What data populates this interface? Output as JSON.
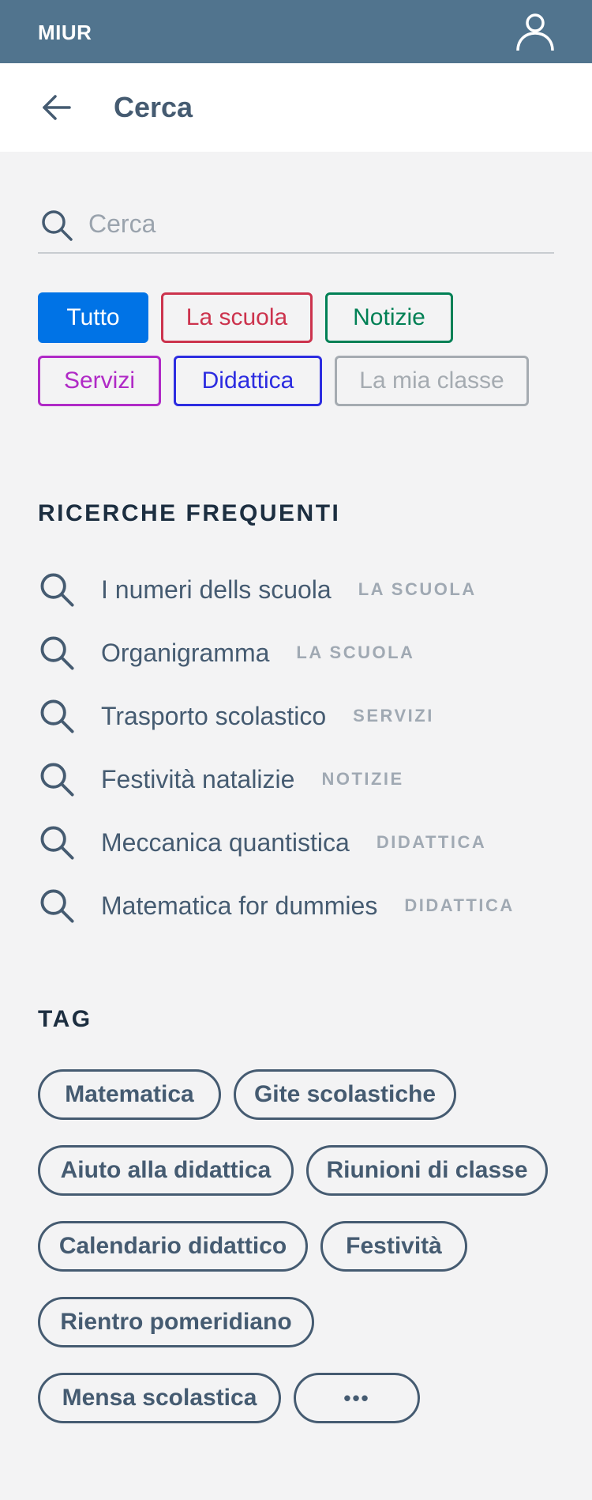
{
  "app": {
    "brand": "MIUR"
  },
  "header": {
    "title": "Cerca"
  },
  "search": {
    "placeholder": "Cerca",
    "value": ""
  },
  "filters": [
    {
      "label": "Tutto",
      "selected": true,
      "color": "#0073e6"
    },
    {
      "label": "La scuola",
      "selected": false,
      "color": "#cc334d"
    },
    {
      "label": "Notizie",
      "selected": false,
      "color": "#008055"
    },
    {
      "label": "Servizi",
      "selected": false,
      "color": "#b02ac6"
    },
    {
      "label": "Didattica",
      "selected": false,
      "color": "#2c2ce0"
    },
    {
      "label": "La mia classe",
      "selected": false,
      "color": "#a5abb1"
    }
  ],
  "frequent": {
    "title": "RICERCHE FREQUENTI",
    "items": [
      {
        "text": "I numeri dells scuola",
        "category": "LA SCUOLA"
      },
      {
        "text": "Organigramma",
        "category": "LA SCUOLA"
      },
      {
        "text": "Trasporto scolastico",
        "category": "SERVIZI"
      },
      {
        "text": "Festività natalizie",
        "category": "NOTIZIE"
      },
      {
        "text": "Meccanica quantistica",
        "category": "DIDATTICA"
      },
      {
        "text": "Matematica for dummies",
        "category": "DIDATTICA"
      }
    ]
  },
  "tags": {
    "title": "TAG",
    "items": [
      "Matematica",
      "Gite scolastiche",
      "Aiuto alla didattica",
      "Riunioni di classe",
      "Calendario didattico",
      "Festività",
      "Rientro pomeridiano",
      "Mensa scolastica"
    ],
    "more_label": "•••"
  },
  "icons": {
    "user": "user-icon",
    "back": "arrow-left-icon",
    "search": "search-icon"
  },
  "colors": {
    "topbar": "#51748e",
    "text": "#455b71",
    "heading": "#1c2e40",
    "category": "#a0a9b3"
  }
}
